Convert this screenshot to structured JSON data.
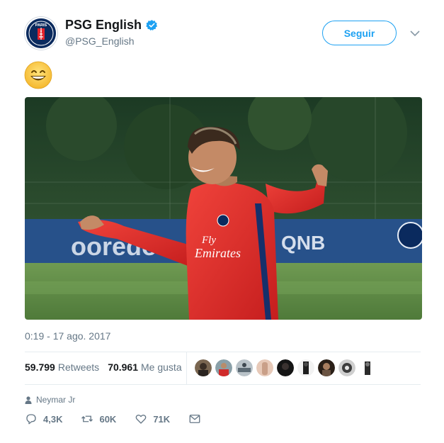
{
  "account": {
    "name": "PSG English",
    "handle": "@PSG_English",
    "verified": true,
    "logo_text": "PARIS"
  },
  "follow_button": {
    "label": "Seguir"
  },
  "tweet": {
    "text_emoji": "grinning-face-with-smiling-eyes",
    "image_description": "photo",
    "shirt_text_1": "Fly",
    "shirt_text_2": "Emirates",
    "board_text_1": "ooredoo",
    "board_text_2": "QNB",
    "timestamp": "0:19 - 17 ago. 2017"
  },
  "stats": {
    "retweets_count": "59.799",
    "retweets_label": "Retweets",
    "likes_count": "70.961",
    "likes_label": "Me gusta",
    "likers_count": 9
  },
  "context": {
    "label": "Neymar Jr",
    "icon": "person-icon"
  },
  "actions": {
    "replies": "4,3K",
    "retweets": "60K",
    "likes": "71K"
  },
  "colors": {
    "accent": "#1da1f2",
    "muted": "#657786",
    "psg_navy": "#0a2a5e",
    "psg_red": "#e4232b"
  }
}
